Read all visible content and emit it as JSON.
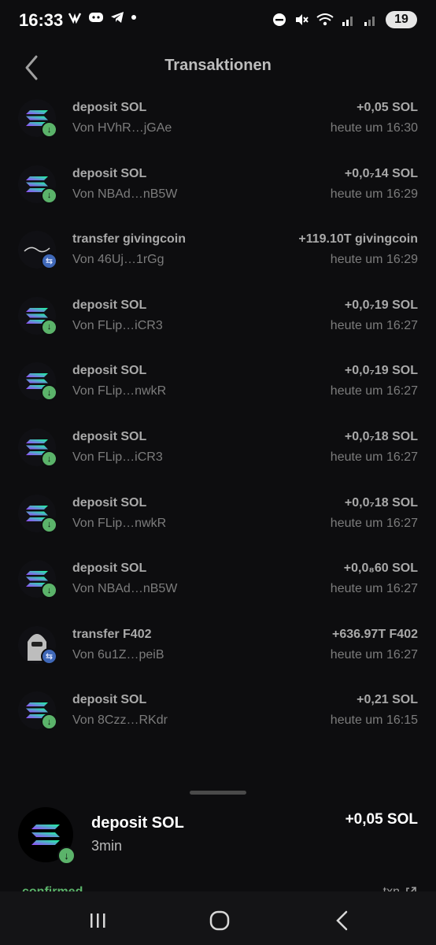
{
  "status": {
    "time": "16:33",
    "battery": "19"
  },
  "header": {
    "title": "Transaktionen"
  },
  "transactions": [
    {
      "name": "deposit SOL",
      "from": "Von HVhR…jGAe",
      "amount": "+0,05 SOL",
      "time": "heute um 16:30",
      "type": "deposit"
    },
    {
      "name": "deposit SOL",
      "from": "Von NBAd…nB5W",
      "amount": "+0,0₇14 SOL",
      "time": "heute um 16:29",
      "type": "deposit"
    },
    {
      "name": "transfer givingcoin",
      "from": "Von 46Uj…1rGg",
      "amount": "+119.10T givingcoin",
      "time": "heute um 16:29",
      "type": "transfer"
    },
    {
      "name": "deposit SOL",
      "from": "Von FLip…iCR3",
      "amount": "+0,0₇19 SOL",
      "time": "heute um 16:27",
      "type": "deposit"
    },
    {
      "name": "deposit SOL",
      "from": "Von FLip…nwkR",
      "amount": "+0,0₇19 SOL",
      "time": "heute um 16:27",
      "type": "deposit"
    },
    {
      "name": "deposit SOL",
      "from": "Von FLip…iCR3",
      "amount": "+0,0₇18 SOL",
      "time": "heute um 16:27",
      "type": "deposit"
    },
    {
      "name": "deposit SOL",
      "from": "Von FLip…nwkR",
      "amount": "+0,0₇18 SOL",
      "time": "heute um 16:27",
      "type": "deposit"
    },
    {
      "name": "deposit SOL",
      "from": "Von NBAd…nB5W",
      "amount": "+0,0₈60 SOL",
      "time": "heute um 16:27",
      "type": "deposit"
    },
    {
      "name": "transfer F402",
      "from": "Von 6u1Z…peiB",
      "amount": "+636.97T F402",
      "time": "heute um 16:27",
      "type": "transfer"
    },
    {
      "name": "deposit SOL",
      "from": "Von 8Czz…RKdr",
      "amount": "+0,21 SOL",
      "time": "heute um 16:15",
      "type": "deposit"
    }
  ],
  "detail": {
    "name": "deposit SOL",
    "sub": "3min",
    "amount": "+0,05 SOL",
    "status": "confirmed",
    "link": "txn"
  },
  "colors": {
    "background": "#0d0d0f",
    "confirmed": "#5bb36a",
    "deposit_badge": "#5bb36a",
    "transfer_badge": "#3f68b8"
  }
}
